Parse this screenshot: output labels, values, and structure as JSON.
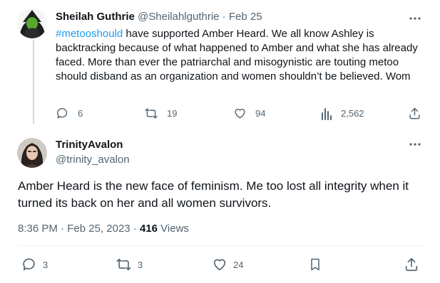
{
  "colors": {
    "accent": "#1d9bf0",
    "muted": "#536471",
    "text": "#0f1419",
    "thread_line": "#cfd9de"
  },
  "tweet1": {
    "name": "Sheilah Guthrie",
    "handle": "@Sheilahlguthrie",
    "separator": "·",
    "date": "Feb 25",
    "hashtag": "#metooshould",
    "text": " have supported Amber Heard. We all know Ashley is backtracking because of what happened to Amber and what she has already faced. More than ever the patriarchal and misogynistic are touting metoo should disband as an organization and women shouldn’t be believed. Wom",
    "replies": "6",
    "retweets": "19",
    "likes": "94",
    "views": "2,562",
    "icons": [
      "reply-icon",
      "retweet-icon",
      "like-icon",
      "views-icon",
      "share-icon",
      "more-icon"
    ]
  },
  "tweet2": {
    "name": "TrinityAvalon",
    "handle": "@trinity_avalon",
    "text": "Amber Heard is the new face of feminism. Me too lost all integrity when it turned its back on her and all women survivors.",
    "time": "8:36 PM",
    "separator": "·",
    "date": "Feb 25, 2023",
    "views_count": "416",
    "views_label": "Views",
    "replies": "3",
    "retweets": "3",
    "likes": "24",
    "icons": [
      "reply-icon",
      "retweet-icon",
      "like-icon",
      "bookmark-icon",
      "share-icon",
      "more-icon"
    ]
  }
}
